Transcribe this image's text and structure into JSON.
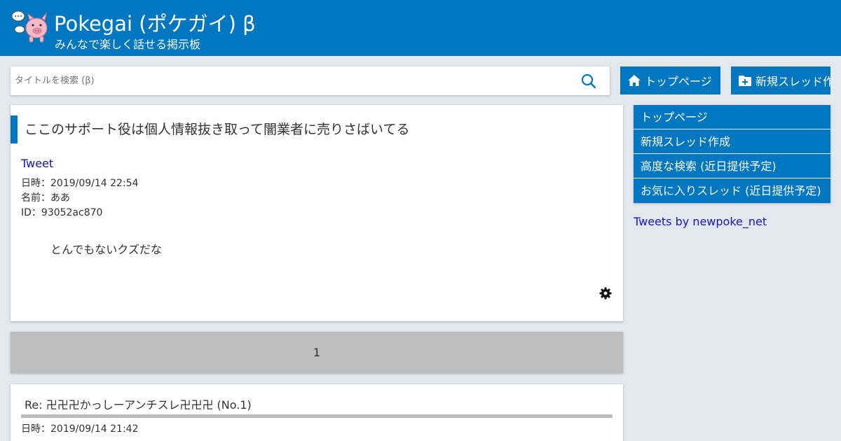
{
  "header": {
    "title": "Pokegai (ポケガイ) β",
    "subtitle": "みんなで楽しく話せる掲示板"
  },
  "search": {
    "placeholder": "タイトルを検索 (β)",
    "icon": "search-icon"
  },
  "top_buttons": {
    "home_label": "トップページ",
    "new_thread_label": "新規スレッド作成"
  },
  "thread": {
    "title": "ここのサポート役は個人情報抜き取って闇業者に売りさばいてる",
    "tweet_label": "Tweet",
    "date": "日時：2019/09/14 22:54",
    "name": "名前：ああ",
    "id": "ID：93052ac870",
    "body": "とんでもないクズだな",
    "settings_icon": "gear-icon"
  },
  "pagination": {
    "current_page": "1"
  },
  "reply": {
    "title": "Re: 卍卍卍かっしーアンチスレ卍卍卍 (No.1)",
    "date": "日時：2019/09/14 21:42"
  },
  "sidebar": {
    "items": [
      {
        "label": "トップページ"
      },
      {
        "label": "新規スレッド作成"
      },
      {
        "label": "高度な検索 (近日提供予定)"
      },
      {
        "label": "お気に入りスレッド (近日提供予定)"
      }
    ],
    "tweets_link": "Tweets by newpoke_net"
  },
  "colors": {
    "brand": "#0077c0",
    "background": "#e3e8ef",
    "pager": "#bdbdbd",
    "link": "#1515c8"
  }
}
